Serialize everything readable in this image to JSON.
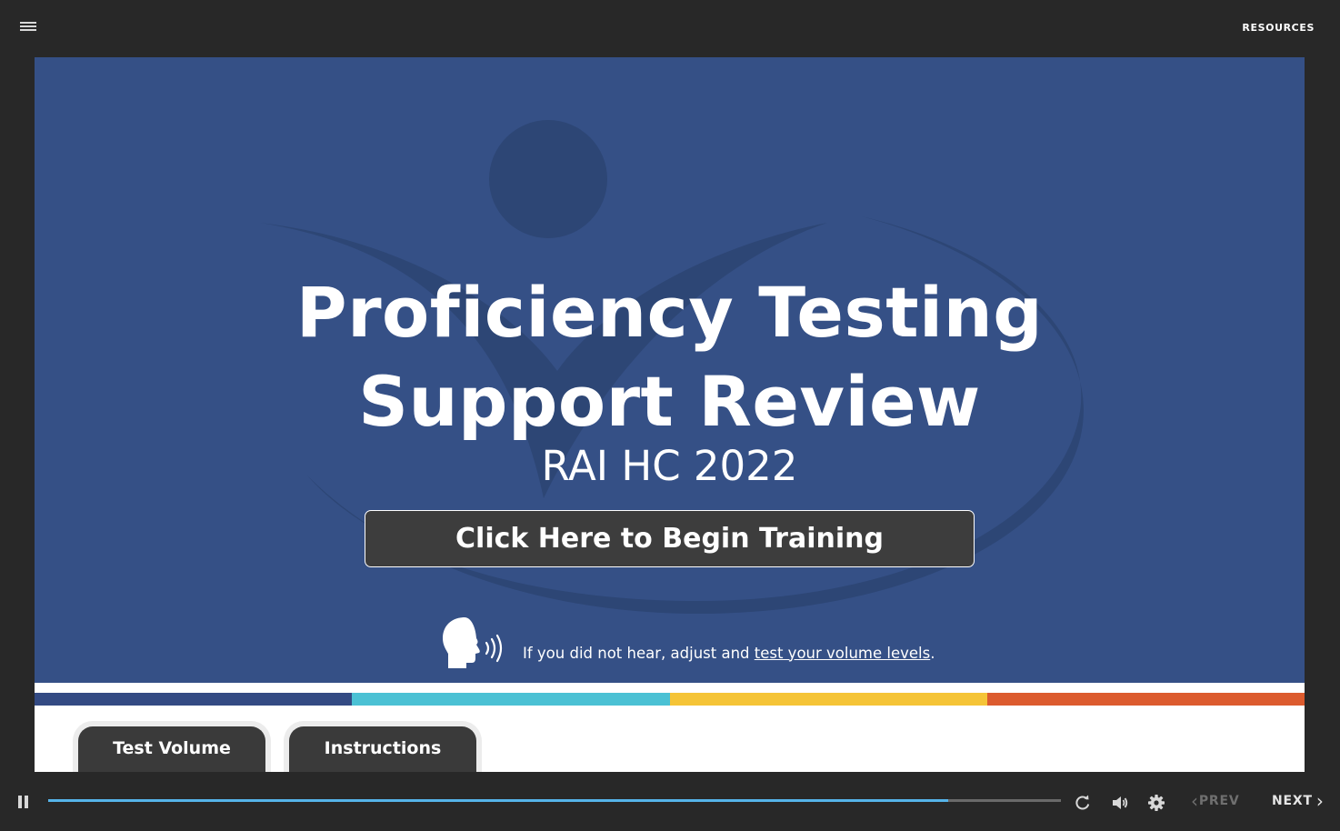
{
  "header": {
    "resources_label": "RESOURCES",
    "menu_icon": "hamburger-menu-icon"
  },
  "slide": {
    "title_line1": "Proficiency Testing",
    "title_line2": "Support Review",
    "subtitle": "RAI HC 2022",
    "begin_button": "Click Here to Begin Training",
    "volume_note": {
      "prefix": "If you did not hear, adjust and ",
      "link": "test your volume levels",
      "suffix": ".",
      "icon": "speaking-head-icon"
    },
    "strip_colors": [
      "#334a83",
      "#4bc1d4",
      "#f5c437",
      "#dc5b2e"
    ],
    "tabs": [
      {
        "label": "Test Volume"
      },
      {
        "label": "Instructions"
      }
    ]
  },
  "player": {
    "progress_fraction": 0.889,
    "prev_label": "PREV",
    "next_label": "NEXT",
    "prev_enabled": false,
    "icons": [
      "pause-icon",
      "replay-icon",
      "volume-icon",
      "settings-gear-icon",
      "chevron-left-icon",
      "chevron-right-icon"
    ],
    "accent_color": "#56b4e9"
  },
  "colors": {
    "hero_background": "#355086",
    "chrome_background": "#282828"
  }
}
